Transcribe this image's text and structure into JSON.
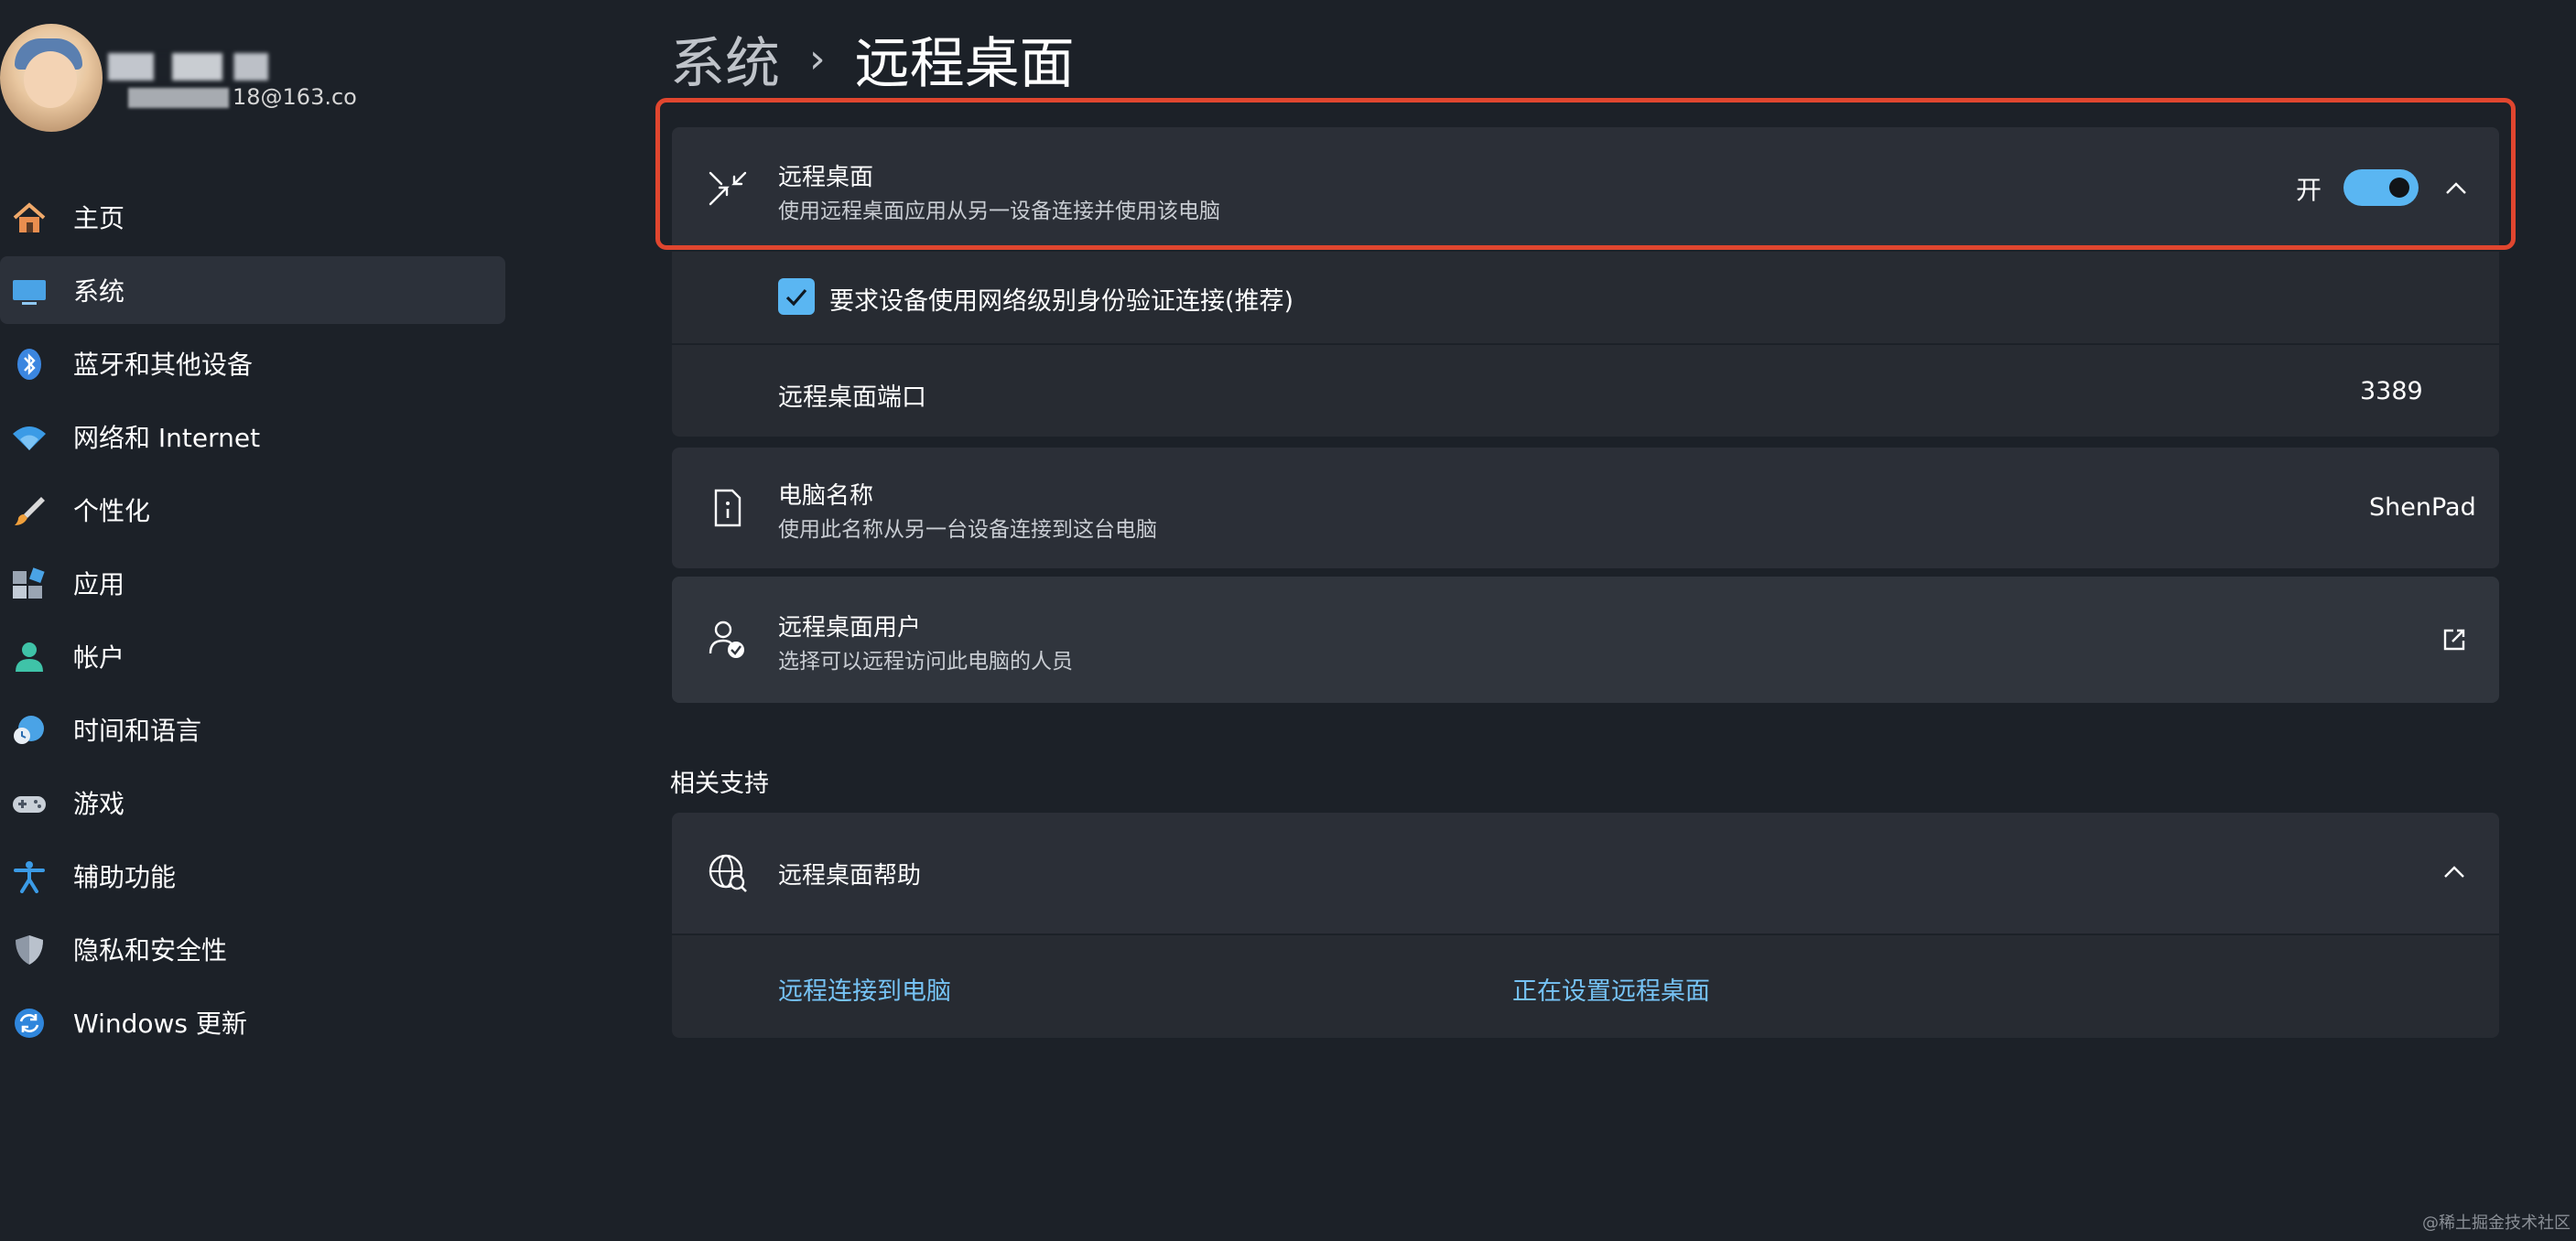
{
  "user": {
    "name": "",
    "email": "18@163.co"
  },
  "sidebar": {
    "items": [
      {
        "label": "主页",
        "icon": "home-icon"
      },
      {
        "label": "系统",
        "icon": "system-display-icon",
        "active": true
      },
      {
        "label": "蓝牙和其他设备",
        "icon": "bluetooth-icon"
      },
      {
        "label": "网络和 Internet",
        "icon": "wifi-icon"
      },
      {
        "label": "个性化",
        "icon": "paintbrush-icon"
      },
      {
        "label": "应用",
        "icon": "apps-icon"
      },
      {
        "label": "帐户",
        "icon": "account-icon"
      },
      {
        "label": "时间和语言",
        "icon": "globe-clock-icon"
      },
      {
        "label": "游戏",
        "icon": "gamepad-icon"
      },
      {
        "label": "辅助功能",
        "icon": "accessibility-icon"
      },
      {
        "label": "隐私和安全性",
        "icon": "shield-icon"
      },
      {
        "label": "Windows 更新",
        "icon": "update-icon"
      }
    ]
  },
  "breadcrumb": {
    "parent": "系统",
    "separator": "›",
    "current": "远程桌面"
  },
  "remote_desktop": {
    "title": "远程桌面",
    "description": "使用远程桌面应用从另一设备连接并使用该电脑",
    "toggle_label": "开",
    "toggle_on": true,
    "nla_checkbox_label": "要求设备使用网络级别身份验证连接(推荐)",
    "nla_checked": true,
    "port_label": "远程桌面端口",
    "port_value": "3389"
  },
  "pc_name": {
    "title": "电脑名称",
    "description": "使用此名称从另一台设备连接到这台电脑",
    "value": "ShenPad"
  },
  "remote_users": {
    "title": "远程桌面用户",
    "description": "选择可以远程访问此电脑的人员"
  },
  "related_support": {
    "section_title": "相关支持",
    "help_title": "远程桌面帮助",
    "links": [
      "远程连接到电脑",
      "正在设置远程桌面"
    ]
  },
  "watermark": "@稀土掘金技术社区",
  "colors": {
    "background": "#1c2128",
    "card": "#2b2f37",
    "accent": "#5ab6f2",
    "link": "#76c3f5",
    "highlight_border": "#e0462f"
  }
}
